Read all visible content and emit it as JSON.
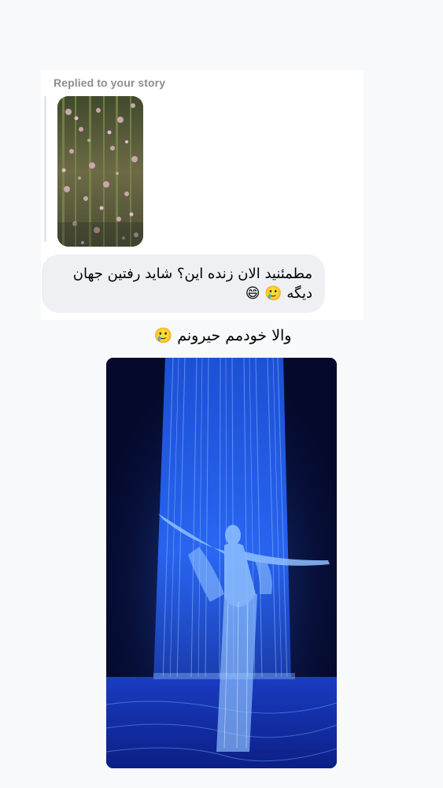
{
  "reply": {
    "label": "Replied to your story",
    "story_thumbnail": "flower-garden-installation"
  },
  "messages": [
    {
      "sender": "other",
      "text": "مطمئنید الان زنده این؟ شاید رفتین جهان دیگه 🥲 😄"
    },
    {
      "sender": "me",
      "text": "والا خودمم حیرونم 🥲"
    },
    {
      "sender": "me",
      "type": "photo",
      "image": "person-under-blue-light-waterfall"
    }
  ],
  "colors": {
    "background": "#f8f9fa",
    "card": "#ffffff",
    "bubble": "#eef0f3",
    "reply_label": "#8a8d91",
    "photo_glow": "#2a6bff"
  }
}
